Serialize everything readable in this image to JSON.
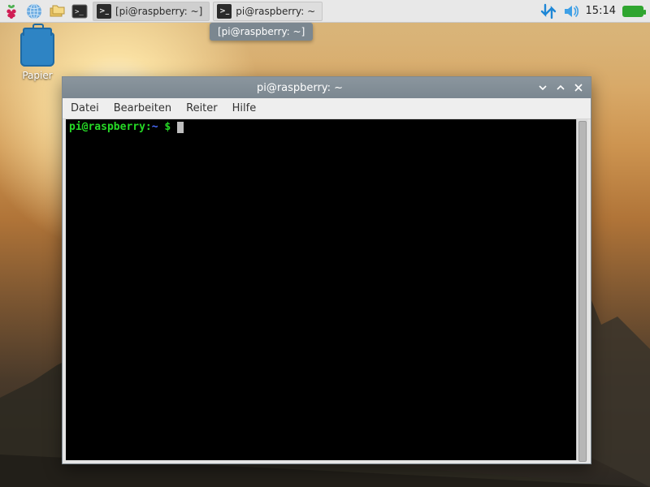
{
  "panel": {
    "tasks": [
      {
        "label": "[pi@raspberry: ~]"
      },
      {
        "label": "pi@raspberry: ~"
      }
    ],
    "clock": "15:14"
  },
  "tooltip": "[pi@raspberry: ~]",
  "desktop": {
    "trash_label": "Papier"
  },
  "terminal": {
    "window_title": "pi@raspberry: ~",
    "menus": {
      "file": "Datei",
      "edit": "Bearbeiten",
      "tabs": "Reiter",
      "help": "Hilfe"
    },
    "prompt": {
      "userhost": "pi@raspberry",
      "sep": ":",
      "path": "~",
      "dollar": " $ "
    }
  }
}
